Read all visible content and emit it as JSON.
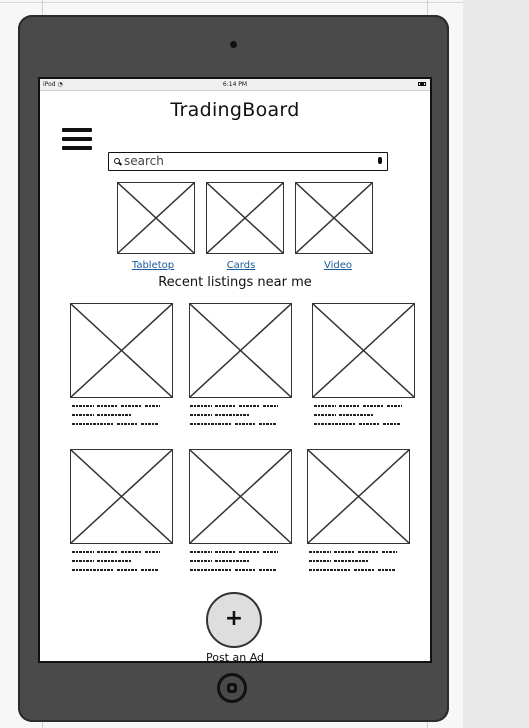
{
  "status_bar": {
    "carrier": "iPod",
    "time": "6:14 PM"
  },
  "app": {
    "title": "TradingBoard"
  },
  "search": {
    "placeholder": "search"
  },
  "categories": [
    {
      "label": "Tabletop"
    },
    {
      "label": "Cards"
    },
    {
      "label": "Video"
    }
  ],
  "recent": {
    "heading": "Recent listings near me"
  },
  "post_ad": {
    "symbol": "+",
    "label": "Post an Ad"
  },
  "icons": {
    "menu": "hamburger-menu-icon",
    "search": "magnifier-icon",
    "mic": "microphone-icon",
    "wifi": "wifi-icon",
    "battery": "battery-icon"
  },
  "colors": {
    "device": "#4a4a4a",
    "link": "#1a5a9a",
    "button_fill": "#dedede"
  }
}
